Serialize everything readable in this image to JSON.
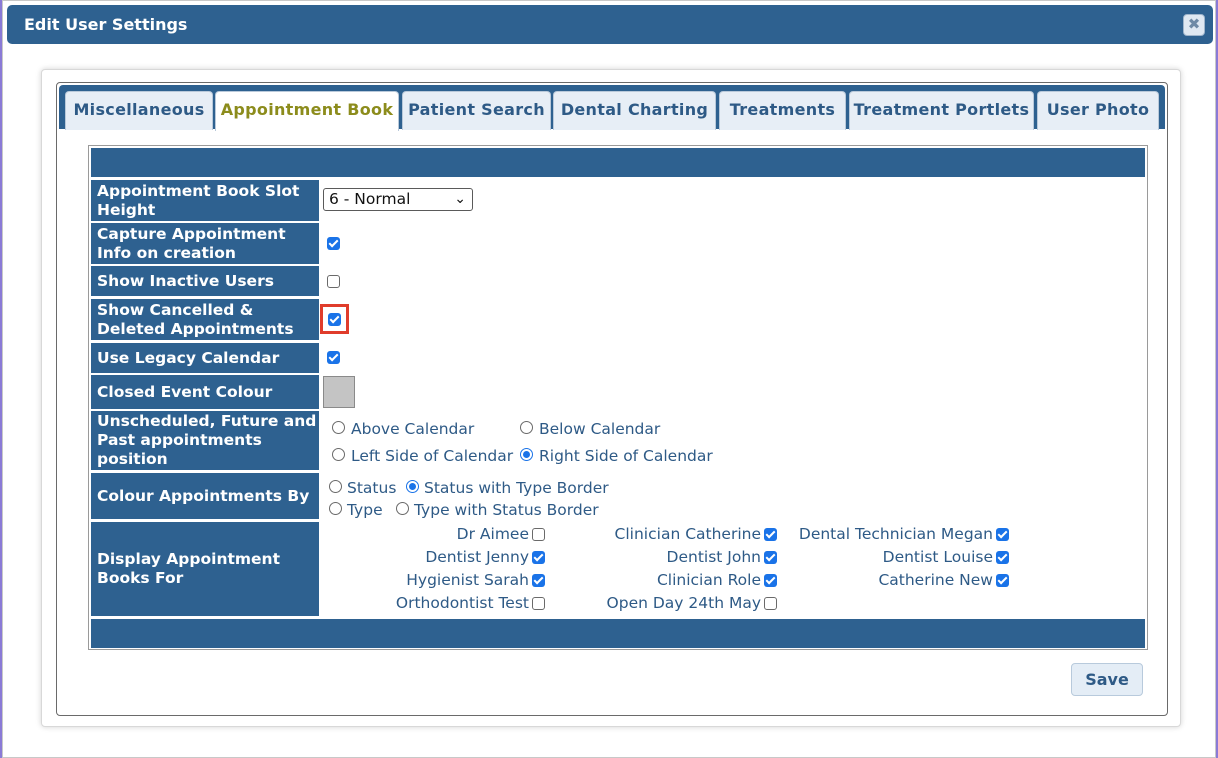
{
  "dialog": {
    "title": "Edit User Settings",
    "close_glyph": "✖"
  },
  "tabs": [
    {
      "label": "Miscellaneous",
      "active": false
    },
    {
      "label": "Appointment Book",
      "active": true
    },
    {
      "label": "Patient Search",
      "active": false
    },
    {
      "label": "Dental Charting",
      "active": false
    },
    {
      "label": "Treatments",
      "active": false
    },
    {
      "label": "Treatment Portlets",
      "active": false
    },
    {
      "label": "User Photo",
      "active": false
    }
  ],
  "settings": {
    "slot_height": {
      "label": "Appointment Book Slot Height",
      "value": "6 - Normal"
    },
    "capture_info": {
      "label": "Capture Appointment Info on creation",
      "checked": true
    },
    "show_inactive": {
      "label": "Show Inactive Users",
      "checked": false
    },
    "show_cancelled": {
      "label": "Show Cancelled & Deleted Appointments",
      "checked": true
    },
    "legacy_calendar": {
      "label": "Use Legacy Calendar",
      "checked": true
    },
    "closed_colour": {
      "label": "Closed Event Colour",
      "color": "#c4c4c4"
    },
    "appt_position": {
      "label": "Unscheduled, Future and Past appointments position",
      "options": [
        {
          "label": "Above Calendar",
          "selected": false
        },
        {
          "label": "Below Calendar",
          "selected": false
        },
        {
          "label": "Left Side of Calendar",
          "selected": false
        },
        {
          "label": "Right Side of Calendar",
          "selected": true
        }
      ]
    },
    "colour_by": {
      "label": "Colour Appointments By",
      "options": [
        {
          "label": "Status",
          "selected": false
        },
        {
          "label": "Status with Type Border",
          "selected": true
        },
        {
          "label": "Type",
          "selected": false
        },
        {
          "label": "Type with Status Border",
          "selected": false
        }
      ]
    },
    "display_books": {
      "label": "Display Appointment Books For",
      "people": [
        {
          "name": "Dr Aimee",
          "checked": false
        },
        {
          "name": "Clinician Catherine",
          "checked": true
        },
        {
          "name": "Dental Technician Megan",
          "checked": true
        },
        {
          "name": "Dentist Jenny",
          "checked": true
        },
        {
          "name": "Dentist John",
          "checked": true
        },
        {
          "name": "Dentist Louise",
          "checked": true
        },
        {
          "name": "Hygienist Sarah",
          "checked": true
        },
        {
          "name": "Clinician Role",
          "checked": true
        },
        {
          "name": "Catherine New",
          "checked": true
        },
        {
          "name": "Orthodontist Test",
          "checked": false
        },
        {
          "name": "Open Day 24th May",
          "checked": false
        }
      ]
    }
  },
  "actions": {
    "save_label": "Save"
  },
  "colors": {
    "header_blue": "#2e6190",
    "accent_blue": "#1a73e8",
    "active_tab_text": "#8c8c1c",
    "highlight_red": "#e03c2b"
  }
}
